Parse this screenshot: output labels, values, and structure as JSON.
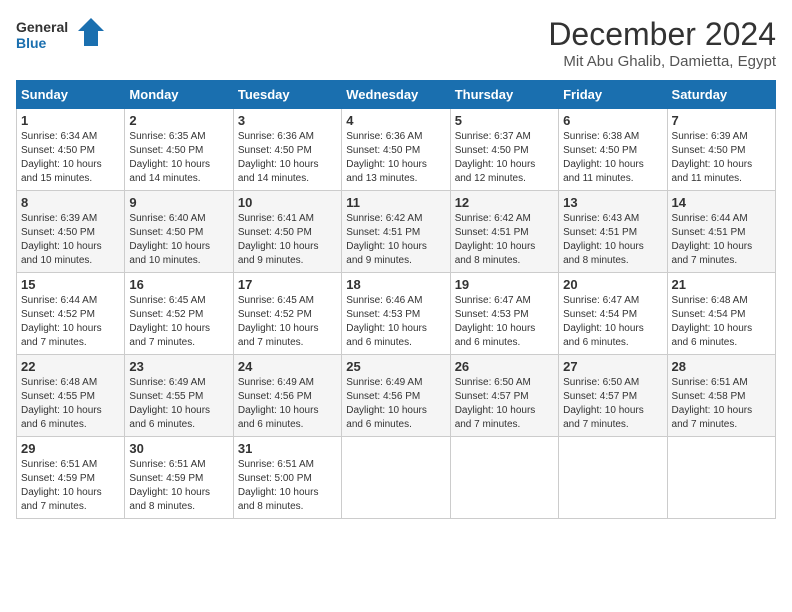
{
  "logo": {
    "line1": "General",
    "line2": "Blue"
  },
  "title": "December 2024",
  "subtitle": "Mit Abu Ghalib, Damietta, Egypt",
  "headers": [
    "Sunday",
    "Monday",
    "Tuesday",
    "Wednesday",
    "Thursday",
    "Friday",
    "Saturday"
  ],
  "weeks": [
    [
      {
        "day": "1",
        "sunrise": "6:34 AM",
        "sunset": "4:50 PM",
        "daylight": "10 hours and 15 minutes."
      },
      {
        "day": "2",
        "sunrise": "6:35 AM",
        "sunset": "4:50 PM",
        "daylight": "10 hours and 14 minutes."
      },
      {
        "day": "3",
        "sunrise": "6:36 AM",
        "sunset": "4:50 PM",
        "daylight": "10 hours and 14 minutes."
      },
      {
        "day": "4",
        "sunrise": "6:36 AM",
        "sunset": "4:50 PM",
        "daylight": "10 hours and 13 minutes."
      },
      {
        "day": "5",
        "sunrise": "6:37 AM",
        "sunset": "4:50 PM",
        "daylight": "10 hours and 12 minutes."
      },
      {
        "day": "6",
        "sunrise": "6:38 AM",
        "sunset": "4:50 PM",
        "daylight": "10 hours and 11 minutes."
      },
      {
        "day": "7",
        "sunrise": "6:39 AM",
        "sunset": "4:50 PM",
        "daylight": "10 hours and 11 minutes."
      }
    ],
    [
      {
        "day": "8",
        "sunrise": "6:39 AM",
        "sunset": "4:50 PM",
        "daylight": "10 hours and 10 minutes."
      },
      {
        "day": "9",
        "sunrise": "6:40 AM",
        "sunset": "4:50 PM",
        "daylight": "10 hours and 10 minutes."
      },
      {
        "day": "10",
        "sunrise": "6:41 AM",
        "sunset": "4:50 PM",
        "daylight": "10 hours and 9 minutes."
      },
      {
        "day": "11",
        "sunrise": "6:42 AM",
        "sunset": "4:51 PM",
        "daylight": "10 hours and 9 minutes."
      },
      {
        "day": "12",
        "sunrise": "6:42 AM",
        "sunset": "4:51 PM",
        "daylight": "10 hours and 8 minutes."
      },
      {
        "day": "13",
        "sunrise": "6:43 AM",
        "sunset": "4:51 PM",
        "daylight": "10 hours and 8 minutes."
      },
      {
        "day": "14",
        "sunrise": "6:44 AM",
        "sunset": "4:51 PM",
        "daylight": "10 hours and 7 minutes."
      }
    ],
    [
      {
        "day": "15",
        "sunrise": "6:44 AM",
        "sunset": "4:52 PM",
        "daylight": "10 hours and 7 minutes."
      },
      {
        "day": "16",
        "sunrise": "6:45 AM",
        "sunset": "4:52 PM",
        "daylight": "10 hours and 7 minutes."
      },
      {
        "day": "17",
        "sunrise": "6:45 AM",
        "sunset": "4:52 PM",
        "daylight": "10 hours and 7 minutes."
      },
      {
        "day": "18",
        "sunrise": "6:46 AM",
        "sunset": "4:53 PM",
        "daylight": "10 hours and 6 minutes."
      },
      {
        "day": "19",
        "sunrise": "6:47 AM",
        "sunset": "4:53 PM",
        "daylight": "10 hours and 6 minutes."
      },
      {
        "day": "20",
        "sunrise": "6:47 AM",
        "sunset": "4:54 PM",
        "daylight": "10 hours and 6 minutes."
      },
      {
        "day": "21",
        "sunrise": "6:48 AM",
        "sunset": "4:54 PM",
        "daylight": "10 hours and 6 minutes."
      }
    ],
    [
      {
        "day": "22",
        "sunrise": "6:48 AM",
        "sunset": "4:55 PM",
        "daylight": "10 hours and 6 minutes."
      },
      {
        "day": "23",
        "sunrise": "6:49 AM",
        "sunset": "4:55 PM",
        "daylight": "10 hours and 6 minutes."
      },
      {
        "day": "24",
        "sunrise": "6:49 AM",
        "sunset": "4:56 PM",
        "daylight": "10 hours and 6 minutes."
      },
      {
        "day": "25",
        "sunrise": "6:49 AM",
        "sunset": "4:56 PM",
        "daylight": "10 hours and 6 minutes."
      },
      {
        "day": "26",
        "sunrise": "6:50 AM",
        "sunset": "4:57 PM",
        "daylight": "10 hours and 7 minutes."
      },
      {
        "day": "27",
        "sunrise": "6:50 AM",
        "sunset": "4:57 PM",
        "daylight": "10 hours and 7 minutes."
      },
      {
        "day": "28",
        "sunrise": "6:51 AM",
        "sunset": "4:58 PM",
        "daylight": "10 hours and 7 minutes."
      }
    ],
    [
      {
        "day": "29",
        "sunrise": "6:51 AM",
        "sunset": "4:59 PM",
        "daylight": "10 hours and 7 minutes."
      },
      {
        "day": "30",
        "sunrise": "6:51 AM",
        "sunset": "4:59 PM",
        "daylight": "10 hours and 8 minutes."
      },
      {
        "day": "31",
        "sunrise": "6:51 AM",
        "sunset": "5:00 PM",
        "daylight": "10 hours and 8 minutes."
      },
      null,
      null,
      null,
      null
    ]
  ]
}
